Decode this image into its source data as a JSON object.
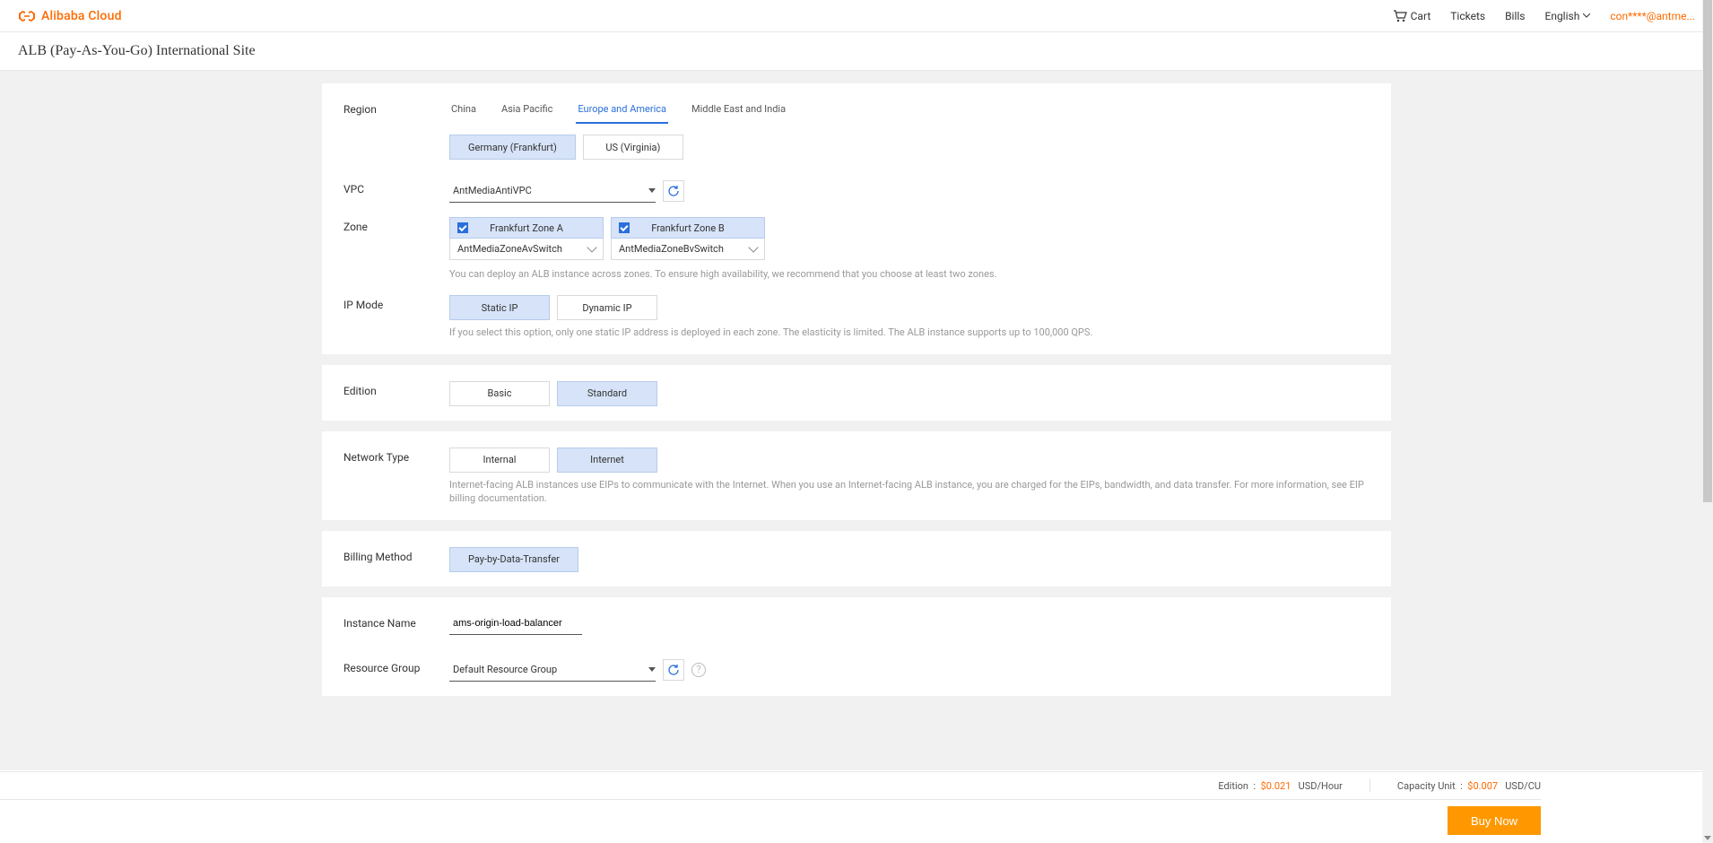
{
  "header": {
    "brand": "Alibaba Cloud",
    "cart": "Cart",
    "tickets": "Tickets",
    "bills": "Bills",
    "language": "English",
    "user": "con****@antme..."
  },
  "page_title": "ALB (Pay-As-You-Go) International Site",
  "region": {
    "label": "Region",
    "tabs": [
      "China",
      "Asia Pacific",
      "Europe and America",
      "Middle East and India"
    ],
    "active_tab": 2,
    "options": [
      {
        "label": "Germany (Frankfurt)",
        "selected": true
      },
      {
        "label": "US (Virginia)",
        "selected": false
      }
    ]
  },
  "vpc": {
    "label": "VPC",
    "value": "AntMediaAntiVPC"
  },
  "zone": {
    "label": "Zone",
    "zones": [
      {
        "name": "Frankfurt Zone A",
        "vswitch": "AntMediaZoneAvSwitch"
      },
      {
        "name": "Frankfurt Zone B",
        "vswitch": "AntMediaZoneBvSwitch"
      }
    ],
    "help": "You can deploy an ALB instance across zones. To ensure high availability, we recommend that you choose at least two zones."
  },
  "ip_mode": {
    "label": "IP Mode",
    "options": [
      {
        "label": "Static IP",
        "selected": true
      },
      {
        "label": "Dynamic IP",
        "selected": false
      }
    ],
    "help": "If you select this option, only one static IP address is deployed in each zone. The elasticity is limited. The ALB instance supports up to 100,000 QPS."
  },
  "edition": {
    "label": "Edition",
    "options": [
      {
        "label": "Basic",
        "selected": false
      },
      {
        "label": "Standard",
        "selected": true
      }
    ]
  },
  "network_type": {
    "label": "Network Type",
    "options": [
      {
        "label": "Internal",
        "selected": false
      },
      {
        "label": "Internet",
        "selected": true
      }
    ],
    "help": "Internet-facing ALB instances use EIPs to communicate with the Internet. When you use an Internet-facing ALB instance, you are charged for the EIPs, bandwidth, and data transfer. For more information, see EIP billing documentation."
  },
  "billing": {
    "label": "Billing Method",
    "options": [
      {
        "label": "Pay-by-Data-Transfer",
        "selected": true
      }
    ]
  },
  "instance_name": {
    "label": "Instance Name",
    "value": "ams-origin-load-balancer"
  },
  "resource_group": {
    "label": "Resource Group",
    "value": "Default Resource Group"
  },
  "footer": {
    "edition_label": "Edition",
    "edition_price": "$0.021",
    "edition_unit": "USD/Hour",
    "capacity_label": "Capacity Unit",
    "capacity_price": "$0.007",
    "capacity_unit": "USD/CU",
    "buy": "Buy Now"
  }
}
